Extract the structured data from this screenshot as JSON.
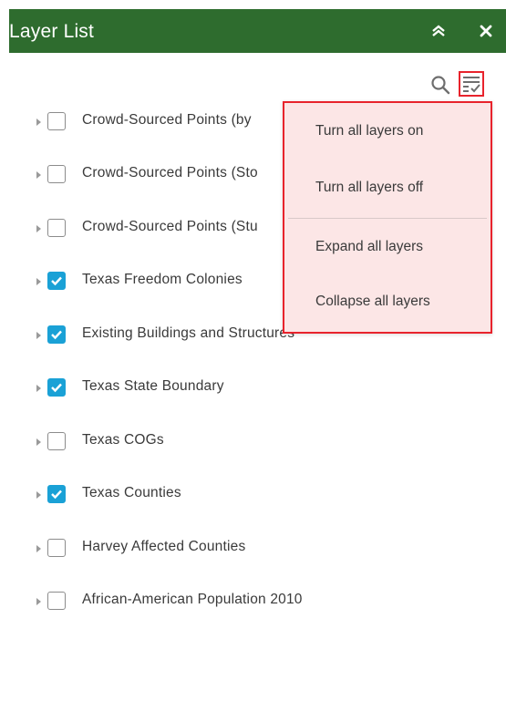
{
  "header": {
    "title": "Layer List",
    "collapse_icon": "double-chevron-up-icon",
    "close_icon": "close-icon"
  },
  "toolbar": {
    "search_icon": "search-icon",
    "menu_icon": "list-options-icon"
  },
  "layers": [
    {
      "label": "Crowd-Sourced Points (by",
      "checked": false
    },
    {
      "label": "Crowd-Sourced Points (Sto",
      "checked": false
    },
    {
      "label": "Crowd-Sourced Points (Stu",
      "checked": false
    },
    {
      "label": "Texas Freedom Colonies",
      "checked": true
    },
    {
      "label": "Existing Buildings and Structures",
      "checked": true
    },
    {
      "label": "Texas State Boundary",
      "checked": true
    },
    {
      "label": "Texas COGs",
      "checked": false
    },
    {
      "label": "Texas Counties",
      "checked": true
    },
    {
      "label": "Harvey Affected Counties",
      "checked": false
    },
    {
      "label": "African-American Population 2010",
      "checked": false
    }
  ],
  "menu": {
    "items": [
      {
        "label": "Turn all layers on"
      },
      {
        "label": "Turn all layers off"
      },
      {
        "label": "Expand all layers"
      },
      {
        "label": "Collapse all layers"
      }
    ]
  },
  "colors": {
    "header_bg": "#2e6c2e",
    "checkbox_on": "#1aa1d6",
    "highlight": "#e8232c",
    "menu_bg": "#fce6e6"
  }
}
